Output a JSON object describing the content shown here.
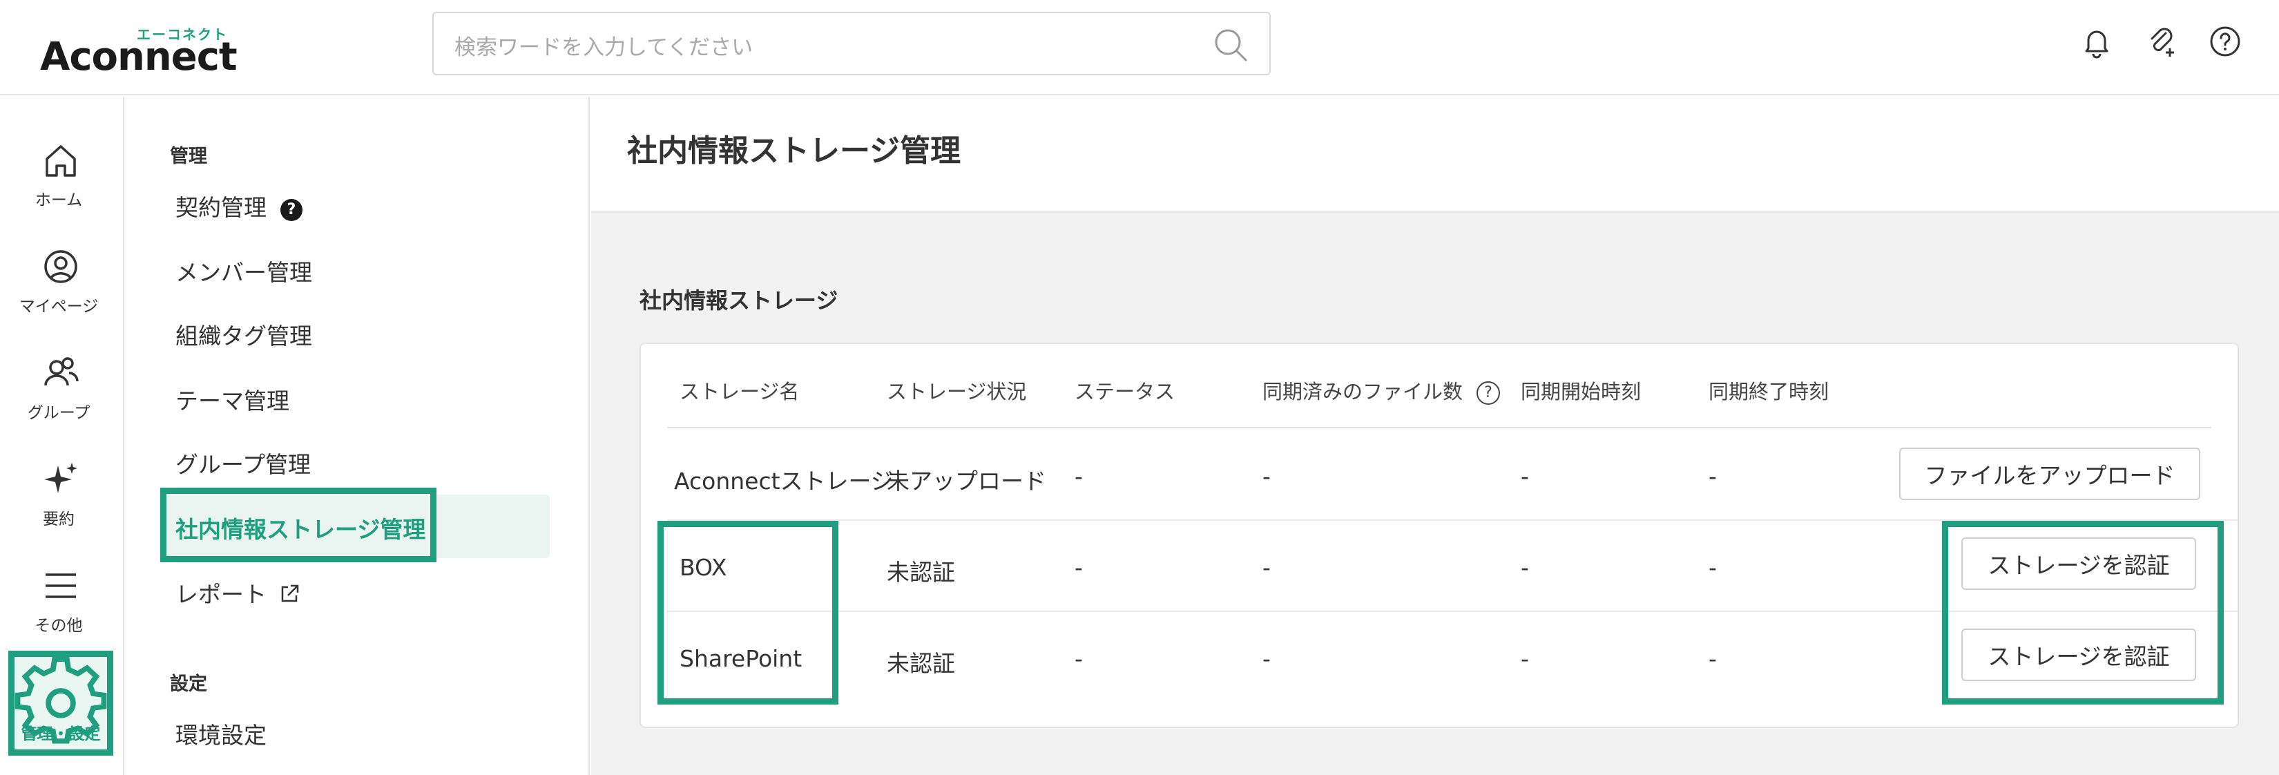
{
  "header": {
    "logo_kana": "エーコネクト",
    "logo_text": "Aconnect",
    "search_placeholder": "検索ワードを入力してください"
  },
  "rail": {
    "items": [
      {
        "label": "ホーム",
        "icon": "home-icon"
      },
      {
        "label": "マイページ",
        "icon": "user-circle-icon"
      },
      {
        "label": "グループ",
        "icon": "group-icon"
      },
      {
        "label": "要約",
        "icon": "sparkle-icon"
      },
      {
        "label": "その他",
        "icon": "menu-icon"
      },
      {
        "label": "管理・設定",
        "icon": "gear-icon"
      }
    ]
  },
  "menu": {
    "section_admin": "管理",
    "items": [
      {
        "label": "契約管理"
      },
      {
        "label": "メンバー管理"
      },
      {
        "label": "組織タグ管理"
      },
      {
        "label": "テーマ管理"
      },
      {
        "label": "グループ管理"
      },
      {
        "label": "社内情報ストレージ管理"
      },
      {
        "label": "レポート"
      }
    ],
    "section_settings": "設定",
    "settings_items": [
      {
        "label": "環境設定"
      }
    ],
    "help_badge": "?"
  },
  "main": {
    "page_title": "社内情報ストレージ管理",
    "section_title": "社内情報ストレージ",
    "columns": [
      "ストレージ名",
      "ストレージ状況",
      "ステータス",
      "同期済みのファイル数",
      "同期開始時刻",
      "同期終了時刻"
    ],
    "help_mark": "?",
    "rows": [
      {
        "name": "Aconnectストレージ",
        "state": "未アップロード",
        "status": "-",
        "files": "-",
        "start": "-",
        "end": "-",
        "action": "ファイルをアップロード"
      },
      {
        "name": "BOX",
        "state": "未認証",
        "status": "-",
        "files": "-",
        "start": "-",
        "end": "-",
        "action": "ストレージを認証"
      },
      {
        "name": "SharePoint",
        "state": "未認証",
        "status": "-",
        "files": "-",
        "start": "-",
        "end": "-",
        "action": "ストレージを認証"
      }
    ]
  },
  "colors": {
    "accent": "#1f9e80",
    "active_bg": "#eaf5f1",
    "content_bg": "#f2f2f2"
  }
}
